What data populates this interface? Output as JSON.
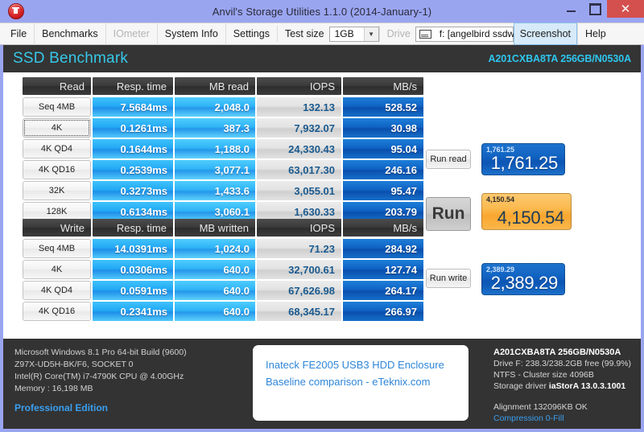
{
  "window": {
    "title": "Anvil's Storage Utilities 1.1.0 (2014-January-1)",
    "icon": "anvil-icon",
    "minimize": "–",
    "maximize": "□",
    "close": "✕"
  },
  "toolbar": {
    "file": "File",
    "benchmarks": "Benchmarks",
    "iometer": "IOmeter",
    "system_info": "System Info",
    "settings": "Settings",
    "test_size_label": "Test size",
    "test_size_value": "1GB",
    "drive_label": "Drive",
    "drive_value": "f: [angelbird ssdwrk]",
    "screenshot": "Screenshot",
    "help": "Help"
  },
  "header": {
    "title": "SSD Benchmark",
    "model": "A201CXBA8TA 256GB/N0530A"
  },
  "read_table": {
    "columns": [
      "Read",
      "Resp. time",
      "MB read",
      "IOPS",
      "MB/s"
    ],
    "rows": [
      {
        "label": "Seq 4MB",
        "resp": "7.5684ms",
        "mb": "2,048.0",
        "iops": "132.13",
        "mbs": "528.52",
        "focused": false
      },
      {
        "label": "4K",
        "resp": "0.1261ms",
        "mb": "387.3",
        "iops": "7,932.07",
        "mbs": "30.98",
        "focused": true
      },
      {
        "label": "4K QD4",
        "resp": "0.1644ms",
        "mb": "1,188.0",
        "iops": "24,330.43",
        "mbs": "95.04",
        "focused": false
      },
      {
        "label": "4K QD16",
        "resp": "0.2539ms",
        "mb": "3,077.1",
        "iops": "63,017.30",
        "mbs": "246.16",
        "focused": false
      },
      {
        "label": "32K",
        "resp": "0.3273ms",
        "mb": "1,433.6",
        "iops": "3,055.01",
        "mbs": "95.47",
        "focused": false
      },
      {
        "label": "128K",
        "resp": "0.6134ms",
        "mb": "3,060.1",
        "iops": "1,630.33",
        "mbs": "203.79",
        "focused": false
      }
    ]
  },
  "write_table": {
    "columns": [
      "Write",
      "Resp. time",
      "MB written",
      "IOPS",
      "MB/s"
    ],
    "rows": [
      {
        "label": "Seq 4MB",
        "resp": "14.0391ms",
        "mb": "1,024.0",
        "iops": "71.23",
        "mbs": "284.92"
      },
      {
        "label": "4K",
        "resp": "0.0306ms",
        "mb": "640.0",
        "iops": "32,700.61",
        "mbs": "127.74"
      },
      {
        "label": "4K QD4",
        "resp": "0.0591ms",
        "mb": "640.0",
        "iops": "67,626.98",
        "mbs": "264.17"
      },
      {
        "label": "4K QD16",
        "resp": "0.2341ms",
        "mb": "640.0",
        "iops": "68,345.17",
        "mbs": "266.97"
      }
    ]
  },
  "scores": {
    "run_read_button": "Run read",
    "run_button": "Run",
    "run_write_button": "Run write",
    "read_score": "1,761.25",
    "total_score": "4,150.54",
    "write_score": "2,389.29"
  },
  "footer": {
    "os": "Microsoft Windows 8.1 Pro 64-bit Build (9600)",
    "board": "Z97X-UD5H-BK/F6, SOCKET 0",
    "cpu": "Intel(R) Core(TM) i7-4790K CPU @ 4.00GHz",
    "memory": "Memory : 16,198 MB",
    "edition": "Professional Edition",
    "note_line1": "Inateck FE2005 USB3 HDD Enclosure",
    "note_line2": "Baseline comparison - eTeknix.com",
    "drive_model": "A201CXBA8TA 256GB/N0530A",
    "drive_space": "Drive F: 238.3/238.2GB free (99.9%)",
    "filesystem": "NTFS - Cluster size 4096B",
    "storage_driver_label": "Storage driver",
    "storage_driver_value": "iaStorA 13.0.3.1001",
    "alignment": "Alignment 132096KB OK",
    "compression": "Compression 0-Fill"
  },
  "colors": {
    "window_frame": "#9aa5f0",
    "header_bar": "#343434",
    "accent_cyan": "#2ec6ef",
    "score_blue": "#1263c2",
    "score_orange": "#f9a72f",
    "close_red": "#d4504e",
    "link_blue": "#3a9ff0"
  }
}
